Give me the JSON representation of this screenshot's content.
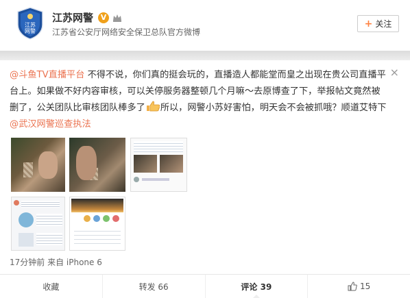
{
  "header": {
    "name": "江苏网警",
    "verified_badge": "V",
    "description": "江苏省公安厅网络安全保卫总队官方微博",
    "follow_label": "关注",
    "follow_plus": "+",
    "avatar_text_top": "江苏",
    "avatar_text_bottom": "网警"
  },
  "post": {
    "mention1": "@斗鱼TV直播平台",
    "text1": " 不得不说，你们真的挺会玩的，直播造人都能堂而皇之出现在贵公司直播平台上。如果做不好内容审核，可以关停服务器整顿几个月嘛～去原博查了下，举报帖文竟然被删了，公关团队比审核团队棒多了",
    "text2": "所以，网警小苏好害怕，明天会不会被抓哦？顺道艾特下",
    "mention2": "@武汉网警巡查执法",
    "close_symbol": "×"
  },
  "meta": {
    "time_source": "17分钟前 来自 iPhone 6"
  },
  "actions": {
    "favorite": "收藏",
    "repost": "转发 66",
    "comment": "评论 39",
    "like": "15"
  },
  "colors": {
    "mention": "#eb7350",
    "badge": "#f0a11b",
    "plus": "#ff8140"
  },
  "icons": [
    "police-badge-avatar",
    "verified-v-icon",
    "crown-icon",
    "thumbs-up-emoji",
    "like-icon",
    "close-icon"
  ]
}
